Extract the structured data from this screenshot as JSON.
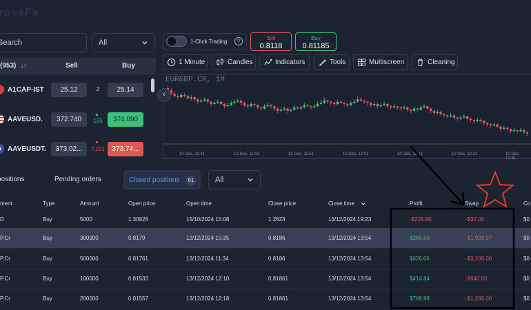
{
  "app": {
    "logo": "rossFx"
  },
  "search": {
    "placeholder": "Search"
  },
  "filter_select": {
    "value": "All"
  },
  "watchlist": {
    "header": {
      "count": "(953)",
      "sort": "↓↑",
      "sell": "Sell",
      "buy": "Buy"
    },
    "rows": [
      {
        "symbol": "A1CAP-IST",
        "sell": "25.12",
        "spread": "2",
        "buy": "25.14",
        "arrow": "",
        "flag_color": "#d93a3a"
      },
      {
        "symbol": "AAVEUSD.",
        "sell": "372.740",
        "spread": "135",
        "buy": "374.090",
        "arrow": "▲",
        "flag_color": "#d94a4a"
      },
      {
        "symbol": "AAVEUSDT.",
        "sell": "373.02...",
        "spread": "7,221",
        "buy": "373.74...",
        "arrow": "▼",
        "flag_color": "#3b4fb0"
      }
    ]
  },
  "trading": {
    "one_click_label": "1-Click Trading",
    "sell_label": "Sell",
    "sell_value": "0.8118",
    "buy_label": "Buy",
    "buy_value": "0.81185"
  },
  "toolbar": {
    "interval": "1 Minute",
    "candles": "Candles",
    "indicators": "Indicators",
    "tools": "Tools",
    "multiscreen": "Multiscreen",
    "cleaning": "Cleaning"
  },
  "chart": {
    "symbol_title": "EURGBP.CR, 1M",
    "x_ticks": [
      "10 Dec, 11:31",
      "10 Dec, 11:41",
      "10 Dec, 11:51",
      "10 Dec, 12:01",
      "10 Dec, 12:11",
      "10 Dec, 12:21",
      "10 Dec, 12:31"
    ]
  },
  "chart_data": {
    "type": "candlestick",
    "candles": [
      [
        60,
        58,
        63,
        57
      ],
      [
        58,
        55,
        60,
        54
      ],
      [
        55,
        53,
        57,
        52
      ],
      [
        53,
        52,
        55,
        50
      ],
      [
        52,
        54,
        56,
        51
      ],
      [
        54,
        53,
        56,
        52
      ],
      [
        53,
        51,
        55,
        50
      ],
      [
        51,
        52,
        54,
        49
      ],
      [
        52,
        50,
        53,
        48
      ],
      [
        50,
        48,
        51,
        46
      ],
      [
        48,
        49,
        51,
        47
      ],
      [
        49,
        50,
        52,
        48
      ],
      [
        50,
        48,
        51,
        46
      ],
      [
        48,
        46,
        49,
        44
      ],
      [
        46,
        47,
        49,
        45
      ],
      [
        47,
        48,
        50,
        46
      ],
      [
        48,
        46,
        49,
        44
      ],
      [
        46,
        44,
        47,
        42
      ],
      [
        44,
        45,
        47,
        43
      ],
      [
        45,
        47,
        49,
        44
      ],
      [
        47,
        48,
        50,
        46
      ],
      [
        48,
        49,
        51,
        47
      ],
      [
        49,
        47,
        50,
        45
      ],
      [
        47,
        45,
        48,
        43
      ],
      [
        45,
        44,
        46,
        42
      ],
      [
        44,
        46,
        48,
        43
      ],
      [
        46,
        45,
        47,
        43
      ],
      [
        45,
        43,
        46,
        41
      ],
      [
        43,
        42,
        44,
        40
      ],
      [
        42,
        44,
        46,
        41
      ],
      [
        44,
        45,
        47,
        43
      ],
      [
        45,
        44,
        46,
        42
      ],
      [
        44,
        42,
        45,
        40
      ],
      [
        42,
        40,
        43,
        38
      ],
      [
        40,
        41,
        43,
        39
      ],
      [
        41,
        42,
        44,
        40
      ],
      [
        42,
        40,
        43,
        38
      ],
      [
        40,
        41,
        42,
        39
      ],
      [
        41,
        43,
        45,
        40
      ],
      [
        43,
        42,
        44,
        41
      ],
      [
        42,
        43,
        45,
        41
      ],
      [
        43,
        45,
        47,
        42
      ],
      [
        45,
        44,
        46,
        43
      ],
      [
        44,
        43,
        45,
        41
      ],
      [
        43,
        44,
        46,
        42
      ],
      [
        44,
        46,
        48,
        43
      ],
      [
        46,
        47,
        50,
        45
      ],
      [
        47,
        49,
        52,
        46
      ],
      [
        49,
        48,
        50,
        46
      ],
      [
        48,
        47,
        49,
        45
      ],
      [
        47,
        46,
        48,
        44
      ],
      [
        46,
        48,
        50,
        45
      ],
      [
        48,
        47,
        49,
        46
      ],
      [
        47,
        46,
        48,
        44
      ],
      [
        46,
        45,
        47,
        43
      ],
      [
        45,
        47,
        49,
        44
      ],
      [
        47,
        48,
        50,
        46
      ],
      [
        48,
        50,
        53,
        47
      ],
      [
        50,
        49,
        52,
        48
      ],
      [
        49,
        48,
        50,
        46
      ],
      [
        48,
        47,
        49,
        45
      ],
      [
        47,
        45,
        48,
        43
      ],
      [
        45,
        46,
        48,
        44
      ],
      [
        46,
        44,
        47,
        42
      ],
      [
        44,
        45,
        47,
        43
      ],
      [
        45,
        46,
        48,
        44
      ],
      [
        46,
        44,
        47,
        42
      ],
      [
        44,
        43,
        45,
        41
      ],
      [
        43,
        44,
        46,
        42
      ],
      [
        44,
        43,
        45,
        41
      ],
      [
        43,
        42,
        44,
        40
      ],
      [
        42,
        43,
        45,
        41
      ],
      [
        43,
        41,
        44,
        39
      ],
      [
        41,
        40,
        42,
        38
      ],
      [
        40,
        42,
        44,
        39
      ],
      [
        42,
        41,
        43,
        39
      ],
      [
        41,
        43,
        45,
        40
      ],
      [
        43,
        44,
        46,
        42
      ],
      [
        44,
        42,
        45,
        41
      ],
      [
        42,
        40,
        43,
        38
      ],
      [
        40,
        38,
        41,
        36
      ],
      [
        38,
        39,
        41,
        37
      ],
      [
        39,
        37,
        40,
        35
      ],
      [
        37,
        36,
        38,
        34
      ],
      [
        36,
        35,
        37,
        33
      ],
      [
        35,
        36,
        38,
        34
      ],
      [
        36,
        34,
        37,
        32
      ],
      [
        34,
        33,
        35,
        31
      ],
      [
        33,
        34,
        36,
        32
      ],
      [
        34,
        35,
        37,
        33
      ],
      [
        35,
        33,
        36,
        31
      ],
      [
        33,
        32,
        34,
        30
      ],
      [
        32,
        31,
        33,
        29
      ],
      [
        31,
        32,
        34,
        30
      ],
      [
        32,
        31,
        33,
        29
      ],
      [
        31,
        29,
        32,
        27
      ],
      [
        29,
        28,
        30,
        26
      ],
      [
        28,
        27,
        29,
        25
      ],
      [
        27,
        28,
        30,
        26
      ],
      [
        28,
        26,
        29,
        25
      ],
      [
        26,
        24,
        27,
        22
      ],
      [
        24,
        25,
        27,
        23
      ],
      [
        25,
        24,
        26,
        22
      ],
      [
        24,
        22,
        25,
        20
      ],
      [
        22,
        23,
        25,
        21
      ],
      [
        23,
        22,
        24,
        20
      ],
      [
        22,
        23,
        25,
        21
      ],
      [
        23,
        21,
        24,
        19
      ],
      [
        21,
        20,
        22,
        18
      ]
    ]
  },
  "orders_tabs": {
    "positions": "positions",
    "pending": "Pending orders",
    "closed": "Closed positions",
    "closed_count": "61",
    "filter": "All"
  },
  "table": {
    "headers": {
      "instrument": "ment",
      "type": "Type",
      "amount": "Amount",
      "open_price": "Open price",
      "open_time": "Open time",
      "close_price": "Close price",
      "close_time": "Close time",
      "profit": "Profit",
      "swap": "Swap",
      "commission": "Co"
    },
    "rows": [
      {
        "instrument": "D",
        "type": "Buy",
        "amount": "5000",
        "open_price": "1.30826",
        "open_time": "15/10/2024 15:08",
        "close_price": "1.2623",
        "close_time": "13/12/2024 19:23",
        "profit": "-$229.80",
        "swap": "-$32.00",
        "comm": "$0"
      },
      {
        "instrument": "P.Cr",
        "type": "Buy",
        "amount": "300000",
        "open_price": "0.8179",
        "open_time": "12/12/2024 15:35",
        "close_price": "0.8186",
        "close_time": "13/12/2024 13:54",
        "profit": "$265.60",
        "swap": "-$1,939.97",
        "comm": "$0"
      },
      {
        "instrument": "P.Cr",
        "type": "Buy",
        "amount": "500000",
        "open_price": "0.81761",
        "open_time": "13/12/2024 11:34",
        "close_price": "0.8186",
        "close_time": "13/12/2024 13:54",
        "profit": "$626.06",
        "swap": "-$3,200.00",
        "comm": "$0"
      },
      {
        "instrument": "P.Cr",
        "type": "Buy",
        "amount": "100000",
        "open_price": "0.81533",
        "open_time": "13/12/2024 12:10",
        "close_price": "0.81861",
        "close_time": "13/12/2024 13:54",
        "profit": "$414.84",
        "swap": "-$640.00",
        "comm": "$0"
      },
      {
        "instrument": "P.Cr",
        "type": "Buy",
        "amount": "200000",
        "open_price": "0.81557",
        "open_time": "13/12/2024 12:18",
        "close_price": "0.81861",
        "close_time": "13/12/2024 13:54",
        "profit": "$768.98",
        "swap": "-$1,280.00",
        "comm": "$0"
      }
    ]
  },
  "colors": {
    "background": "#1c2331",
    "profit_positive": "#3fbf7a",
    "negative": "#e05757",
    "accent": "#4d9be6",
    "annotation": "#e03a2a"
  }
}
